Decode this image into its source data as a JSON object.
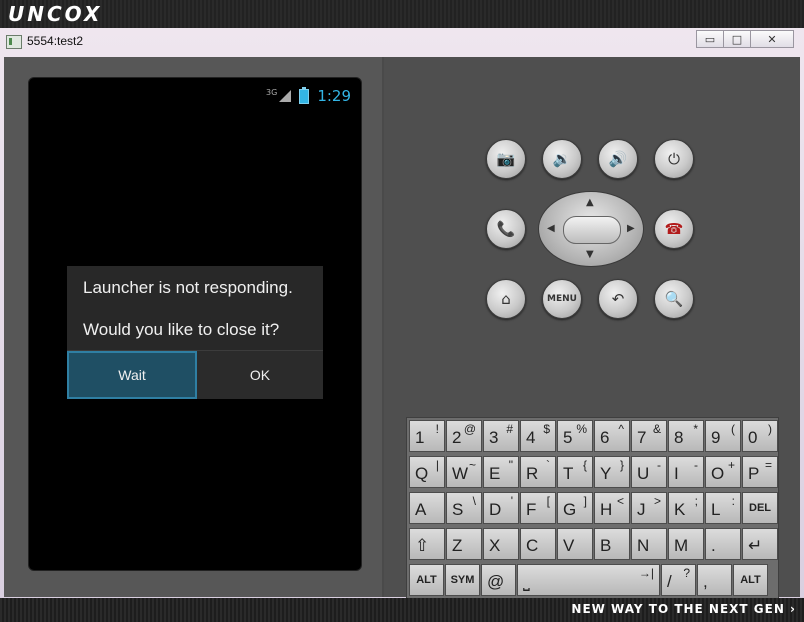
{
  "banner": {
    "brand": "UNCOX",
    "tagline": "NEW WAY TO THE NEXT GEN ›"
  },
  "window": {
    "title": "5554:test2",
    "controls": [
      "▭",
      "□",
      "✕"
    ]
  },
  "statusbar": {
    "network": "3G",
    "time": "1:29"
  },
  "dialog": {
    "message1": "Launcher is not responding.",
    "message2": "Would you like to close it?",
    "wait_label": "Wait",
    "ok_label": "OK"
  },
  "hardware_buttons": {
    "row1": [
      "camera-icon",
      "volume-down-icon",
      "volume-up-icon",
      "power-icon"
    ],
    "row2": [
      "call-icon",
      "end-call-icon"
    ],
    "row3": [
      "home-icon",
      "menu-button",
      "back-icon",
      "search-icon"
    ],
    "menu_label": "MENU",
    "glyphs": {
      "camera": "📷",
      "vol_down": "🔉",
      "vol_up": "🔊",
      "power": "⏻",
      "call": "📞",
      "endcall": "☎",
      "home": "⌂",
      "back": "↶",
      "search": "🔍"
    }
  },
  "keyboard": {
    "row1": [
      [
        "1",
        "!"
      ],
      [
        "2",
        "@"
      ],
      [
        "3",
        "#"
      ],
      [
        "4",
        "$"
      ],
      [
        "5",
        "%"
      ],
      [
        "6",
        "^"
      ],
      [
        "7",
        "&"
      ],
      [
        "8",
        "*"
      ],
      [
        "9",
        "("
      ],
      [
        "0",
        ")"
      ]
    ],
    "row2": [
      [
        "Q",
        "|"
      ],
      [
        "W",
        "~"
      ],
      [
        "E",
        "\""
      ],
      [
        "R",
        "`"
      ],
      [
        "T",
        "{"
      ],
      [
        "Y",
        "}"
      ],
      [
        "U",
        "-"
      ],
      [
        "I",
        "-"
      ],
      [
        "O",
        "+"
      ],
      [
        "P",
        "="
      ]
    ],
    "row3": [
      [
        "A",
        ""
      ],
      [
        "S",
        "\\"
      ],
      [
        "D",
        "'"
      ],
      [
        "F",
        "["
      ],
      [
        "G",
        "]"
      ],
      [
        "H",
        "<"
      ],
      [
        "J",
        ">"
      ],
      [
        "K",
        ";"
      ],
      [
        "L",
        ":"
      ],
      [
        "DEL",
        ""
      ]
    ],
    "row4": [
      [
        "⇧",
        ""
      ],
      [
        "Z",
        ""
      ],
      [
        "X",
        ""
      ],
      [
        "C",
        ""
      ],
      [
        "V",
        ""
      ],
      [
        "B",
        ""
      ],
      [
        "N",
        ""
      ],
      [
        "M",
        ""
      ],
      [
        ".",
        ""
      ],
      [
        "↵",
        ""
      ]
    ],
    "row5": [
      [
        "ALT",
        ""
      ],
      [
        "SYM",
        ""
      ],
      [
        "@",
        ""
      ],
      [
        "⎵",
        "→|"
      ],
      [
        "/",
        "?"
      ],
      [
        ",",
        ""
      ],
      [
        "ALT",
        ""
      ]
    ]
  }
}
